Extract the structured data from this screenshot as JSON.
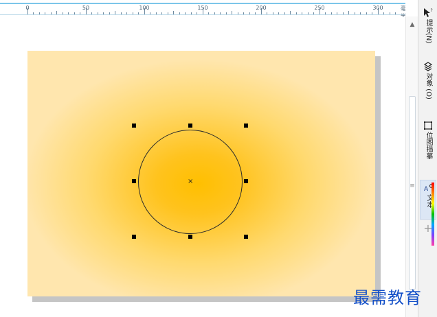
{
  "ruler": {
    "labels": [
      "0",
      "50",
      "100",
      "150",
      "200",
      "250",
      "300"
    ],
    "unit": "毫米"
  },
  "docker": {
    "tabs": [
      {
        "label": "提示(N)",
        "icon": "question-pointer-icon"
      },
      {
        "label": "对象 (O)",
        "icon": "object-stack-icon"
      },
      {
        "label": "位图描摹",
        "icon": "bitmap-trace-icon"
      },
      {
        "label": "文本",
        "icon": "text-tool-icon"
      }
    ],
    "add_icon": "plus-icon"
  },
  "canvas": {
    "background": "#ffffff",
    "page_gradient": [
      "#ffbf00",
      "#ffc31e",
      "#ffd96e",
      "#ffe6ae"
    ],
    "selection_color": "#000000"
  },
  "watermark": {
    "text": "最需教育"
  }
}
